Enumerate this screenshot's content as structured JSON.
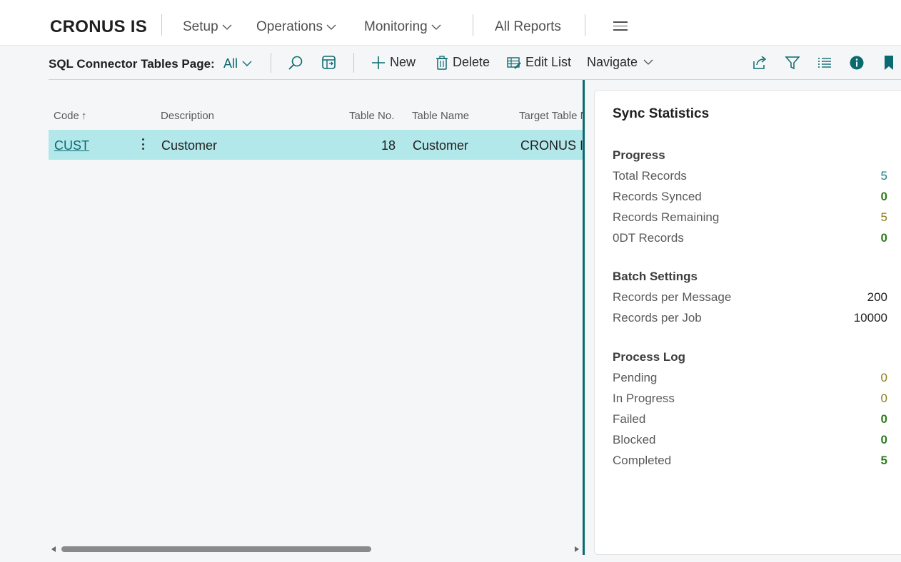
{
  "topnav": {
    "company": "CRONUS IS",
    "items": [
      {
        "label": "Setup"
      },
      {
        "label": "Operations"
      },
      {
        "label": "Monitoring"
      },
      {
        "label": "All Reports"
      }
    ],
    "menu_icon": "hamburger-icon"
  },
  "actionbar": {
    "caption": "SQL Connector Tables Page:",
    "view": "All",
    "new_label": "New",
    "delete_label": "Delete",
    "edit_list_label": "Edit List",
    "navigate_label": "Navigate",
    "icons": [
      "search-icon",
      "edit-in-excel-icon",
      "share-icon",
      "filter-icon",
      "list-view-icon",
      "info-icon",
      "bookmark-icon"
    ]
  },
  "list": {
    "columns": {
      "code": "Code",
      "description": "Description",
      "table_no": "Table No.",
      "table_name": "Table Name",
      "target_table": "Target Table N"
    },
    "sort_indicator": "↑",
    "rows": [
      {
        "code": "CUST",
        "description": "Customer",
        "table_no": "18",
        "table_name": "Customer",
        "target_table": "CRONUS IS"
      }
    ]
  },
  "factbox": {
    "title": "Sync Statistics",
    "progress": {
      "title": "Progress",
      "total_records": {
        "label": "Total Records",
        "value": "5"
      },
      "records_synced": {
        "label": "Records Synced",
        "value": "0"
      },
      "records_remaining": {
        "label": "Records Remaining",
        "value": "5"
      },
      "odt_records": {
        "label": "0DT Records",
        "value": "0"
      }
    },
    "batch": {
      "title": "Batch Settings",
      "per_message": {
        "label": "Records per Message",
        "value": "200"
      },
      "per_job": {
        "label": "Records per Job",
        "value": "10000"
      }
    },
    "log": {
      "title": "Process Log",
      "pending": {
        "label": "Pending",
        "value": "0"
      },
      "in_progress": {
        "label": "In Progress",
        "value": "0"
      },
      "failed": {
        "label": "Failed",
        "value": "0"
      },
      "blocked": {
        "label": "Blocked",
        "value": "0"
      },
      "completed": {
        "label": "Completed",
        "value": "5"
      }
    }
  },
  "colors": {
    "accent": "#0b6a6f",
    "selected_row": "#b3e8eb",
    "value_teal": "#1a7b86",
    "value_green": "#2e7d1e",
    "value_olive": "#8a7a1a"
  }
}
